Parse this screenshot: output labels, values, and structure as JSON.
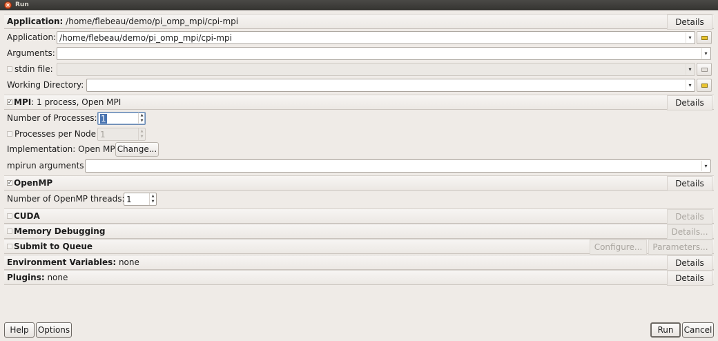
{
  "window": {
    "title": "Run"
  },
  "application_header": {
    "label": "Application:",
    "value": "/home/flebeau/demo/pi_omp_mpi/cpi-mpi",
    "details": "Details"
  },
  "application": {
    "label": "Application:",
    "value": "/home/flebeau/demo/pi_omp_mpi/cpi-mpi"
  },
  "arguments": {
    "label": "Arguments:",
    "value": ""
  },
  "stdin": {
    "label": "stdin file:",
    "value": ""
  },
  "working_directory": {
    "label": "Working Directory:",
    "value": ""
  },
  "mpi": {
    "title": "MPI",
    "summary": ": 1 process, Open MPI",
    "details": "Details",
    "num_processes_label": "Number of Processes:",
    "num_processes": "1",
    "per_node_label": "Processes per Node",
    "per_node": "1",
    "implementation_label": "Implementation: Open MPI",
    "change": "Change...",
    "mpirun_label": "mpirun arguments",
    "mpirun_value": ""
  },
  "openmp": {
    "title": "OpenMP",
    "details": "Details",
    "threads_label": "Number of OpenMP threads:",
    "threads": "1"
  },
  "cuda": {
    "title": "CUDA",
    "details": "Details"
  },
  "memory": {
    "title": "Memory Debugging",
    "details": "Details..."
  },
  "queue": {
    "title": "Submit to Queue",
    "configure": "Configure...",
    "parameters": "Parameters..."
  },
  "env": {
    "title": "Environment Variables:",
    "value": " none",
    "details": "Details"
  },
  "plugins": {
    "title": "Plugins:",
    "value": " none",
    "details": "Details"
  },
  "footer": {
    "help": "Help",
    "options": "Options",
    "run": "Run",
    "cancel": "Cancel"
  }
}
